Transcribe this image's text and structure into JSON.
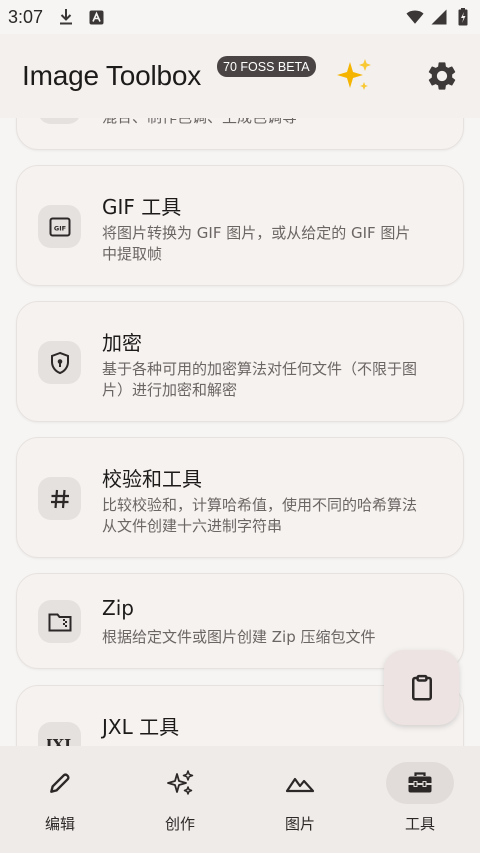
{
  "status_bar": {
    "time": "3:07"
  },
  "app_bar": {
    "title": "Image Toolbox",
    "badge": "70 FOSS BETA"
  },
  "cards": [
    {
      "icon": "palette-icon",
      "title": "",
      "desc": "混合、制作色调、生成色调等"
    },
    {
      "icon": "gif-icon",
      "title": "GIF 工具",
      "desc": "将图片转换为 GIF 图片，或从给定的 GIF 图片中提取帧"
    },
    {
      "icon": "lock-shield-icon",
      "title": "加密",
      "desc": "基于各种可用的加密算法对任何文件（不限于图片）进行加密和解密"
    },
    {
      "icon": "hash-icon",
      "title": "校验和工具",
      "desc": "比较校验和，计算哈希值，使用不同的哈希算法从文件创建十六进制字符串"
    },
    {
      "icon": "zip-folder-icon",
      "title": "Zip",
      "desc": "根据给定文件或图片创建 Zip 压缩包文件"
    },
    {
      "icon": "jxl-icon",
      "title": "JXL 工具",
      "desc": ""
    }
  ],
  "fab": {
    "icon": "clipboard-icon"
  },
  "bottom_nav": [
    {
      "label": "编辑",
      "icon": "edit-icon",
      "active": false
    },
    {
      "label": "创作",
      "icon": "sparkles-icon",
      "active": false
    },
    {
      "label": "图片",
      "icon": "image-icon",
      "active": false
    },
    {
      "label": "工具",
      "icon": "toolbox-icon",
      "active": true
    }
  ]
}
